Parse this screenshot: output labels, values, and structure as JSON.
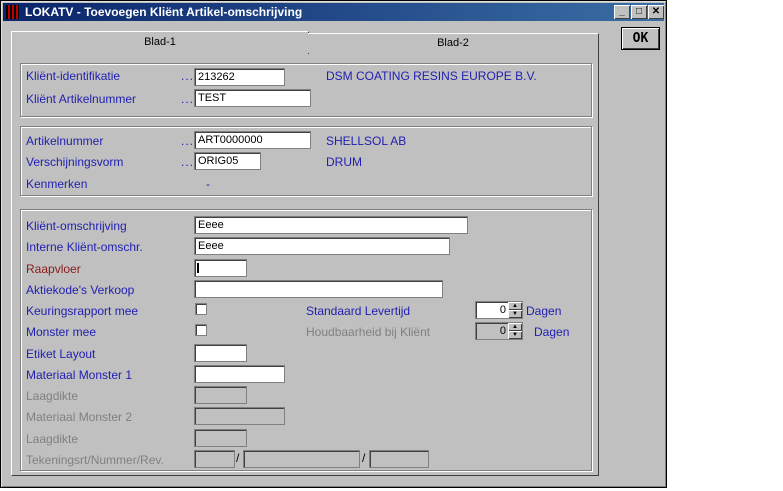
{
  "window": {
    "title": "LOKATV - Toevoegen Kliënt Artikel-omschrijving",
    "min": "_",
    "max": "□",
    "close": "✕"
  },
  "ok_label": "OK",
  "tabs": [
    "Blad-1",
    "Blad-2"
  ],
  "dots": "...",
  "group1": {
    "klient_id_label": "Kliënt-identifikatie",
    "klient_id_value": "213262",
    "klient_name": "DSM COATING RESINS EUROPE B.V.",
    "klient_art_label": "Kliënt Artikelnummer",
    "klient_art_value": "TEST"
  },
  "group2": {
    "artikel_label": "Artikelnummer",
    "artikel_value": "ART0000000",
    "artikel_name": "SHELLSOL AB",
    "verschijning_label": "Verschijningsvorm",
    "verschijning_value": "ORIG05",
    "verschijning_name": "DRUM",
    "kenmerken_label": "Kenmerken",
    "kenmerken_value": "-"
  },
  "group3": {
    "omschrijving_label": "Kliënt-omschrijving",
    "omschrijving_value": "Eeee",
    "interne_label": "Interne Kliënt-omschr.",
    "interne_value": "Eeee",
    "raapvloer_label": "Raapvloer",
    "raapvloer_value": "",
    "aktiekode_label": "Aktiekode's Verkoop",
    "aktiekode_value": "",
    "keuring_label": "Keuringsrapport mee",
    "monster_label": "Monster mee",
    "standaard_label": "Standaard Levertijd",
    "standaard_value": "0",
    "standaard_unit": "Dagen",
    "houdbaar_label": "Houdbaarheid bij Kliënt",
    "houdbaar_value": "0",
    "houdbaar_unit": "Dagen",
    "etiket_label": "Etiket Layout",
    "materiaal1_label": "Materiaal Monster 1",
    "laagdikte1_label": "Laagdikte",
    "materiaal2_label": "Materiaal Monster 2",
    "laagdikte2_label": "Laagdikte",
    "tekening_label": "Tekeningsrt/Nummer/Rev.",
    "slash": "/"
  }
}
